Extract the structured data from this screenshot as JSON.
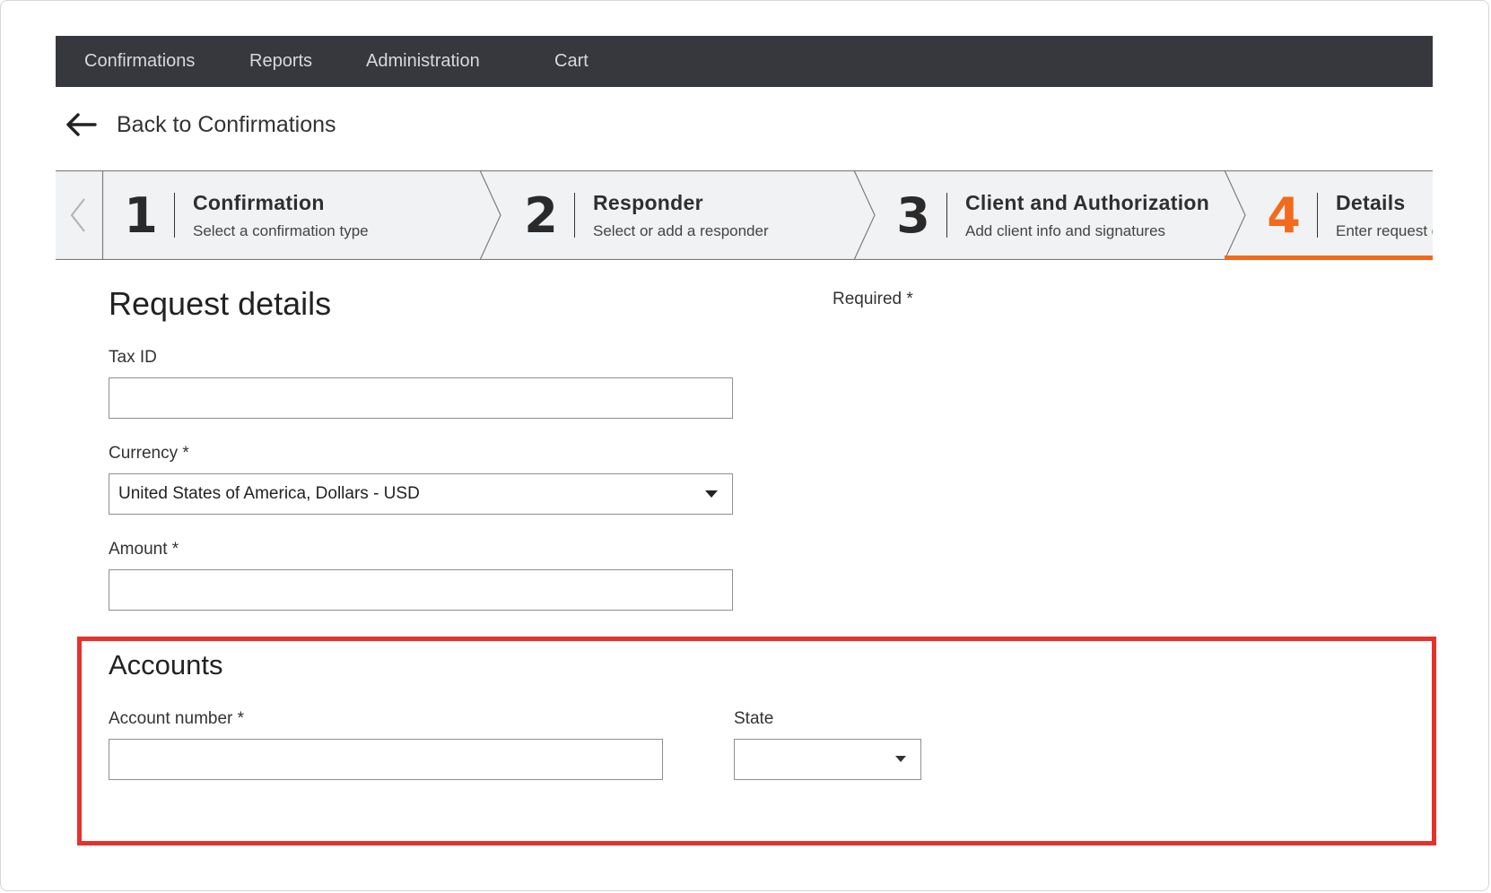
{
  "nav": {
    "items": [
      {
        "label": "Confirmations"
      },
      {
        "label": "Reports"
      },
      {
        "label": "Administration"
      },
      {
        "label": "Cart"
      }
    ]
  },
  "back": {
    "label": "Back to Confirmations",
    "icon": "arrow-left-icon"
  },
  "stepper": {
    "prev_icon": "chevron-left-icon",
    "steps": [
      {
        "number": "1",
        "title": "Confirmation",
        "subtitle": "Select a confirmation type",
        "active": false
      },
      {
        "number": "2",
        "title": "Responder",
        "subtitle": "Select or add a responder",
        "active": false
      },
      {
        "number": "3",
        "title": "Client and Authorization",
        "subtitle": "Add client info and signatures",
        "active": false
      },
      {
        "number": "4",
        "title": "Details",
        "subtitle": "Enter request de",
        "active": true
      }
    ],
    "active_color": "#f26a1b"
  },
  "form": {
    "heading": "Request details",
    "required_note": "Required *",
    "tax_id": {
      "label": "Tax ID",
      "value": ""
    },
    "currency": {
      "label": "Currency *",
      "value": "United States of America, Dollars - USD"
    },
    "amount": {
      "label": "Amount *",
      "value": ""
    }
  },
  "accounts": {
    "title": "Accounts",
    "account_number": {
      "label": "Account number *",
      "value": ""
    },
    "state": {
      "label": "State",
      "value": ""
    },
    "highlight_color": "#e5322b"
  },
  "colors": {
    "nav_bg": "#36383d",
    "stepper_bg": "#f1f2f4"
  }
}
